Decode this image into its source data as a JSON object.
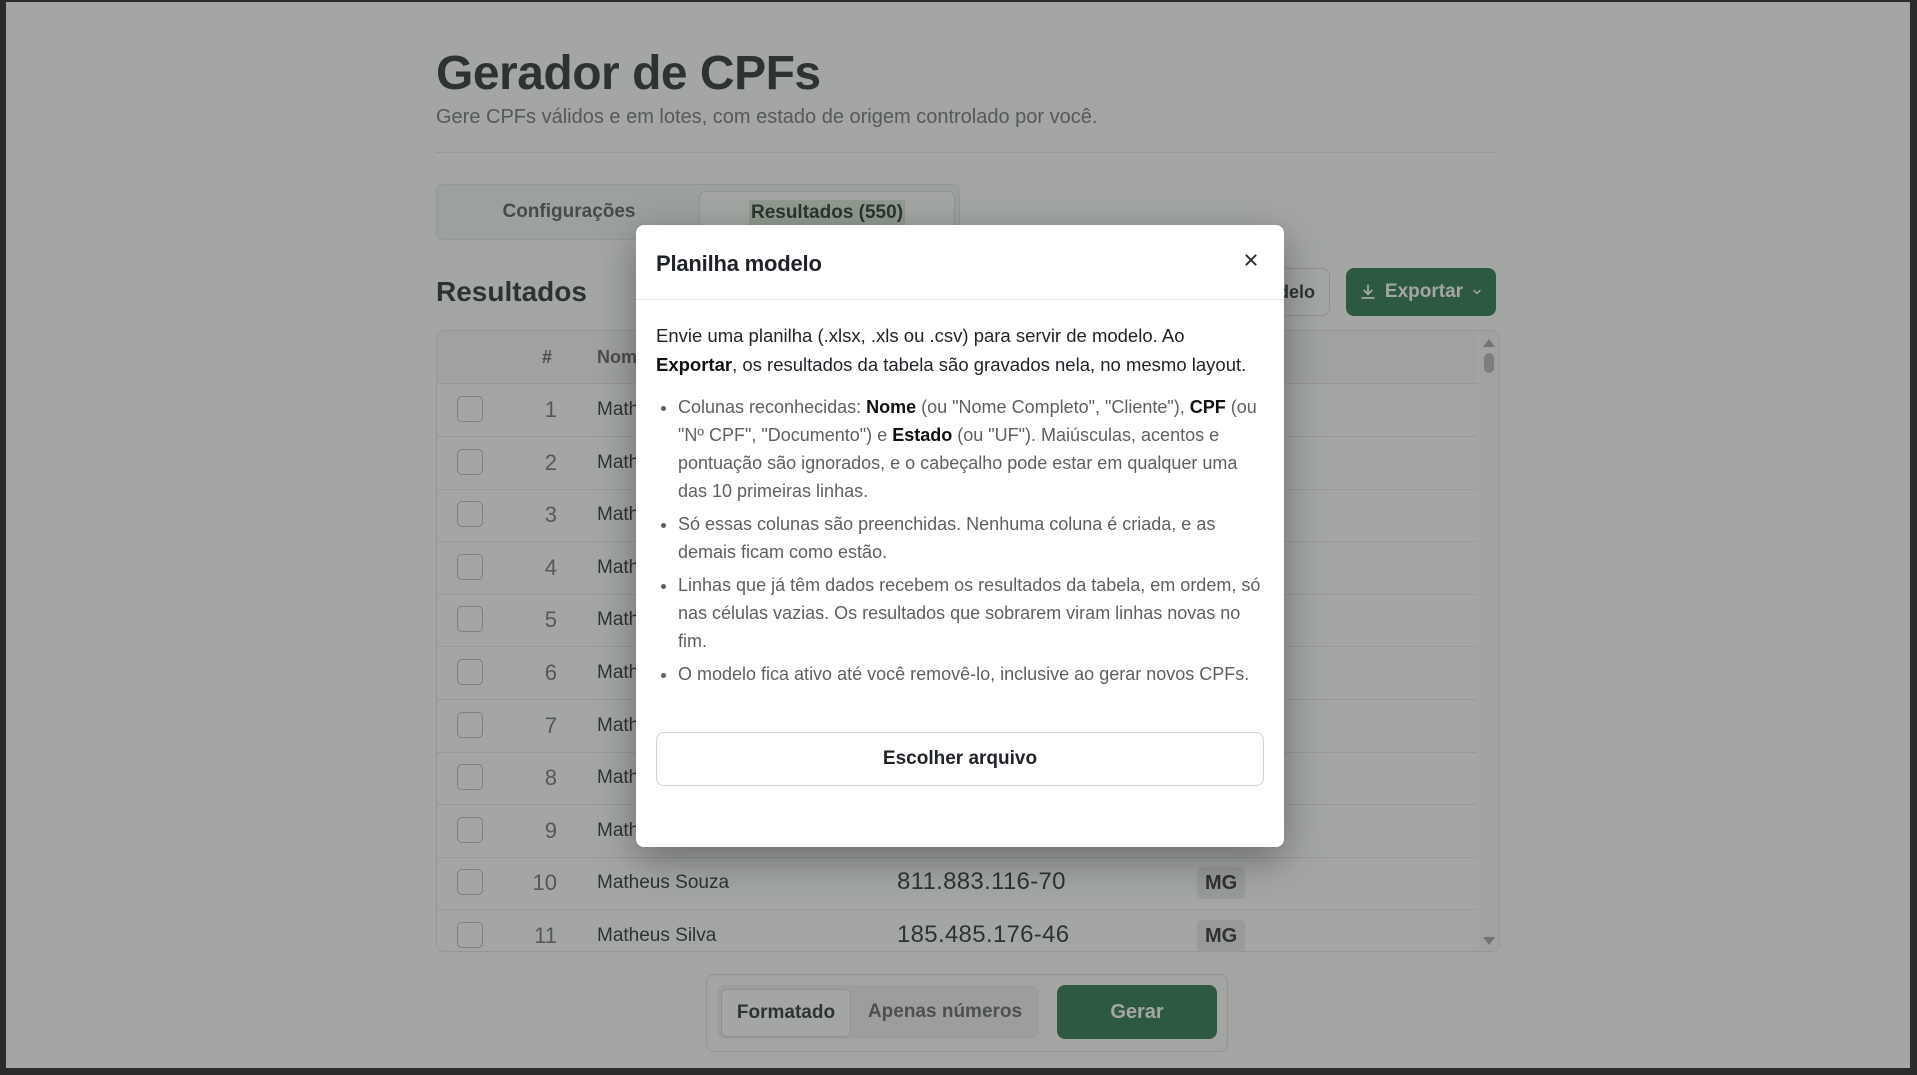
{
  "header": {
    "title": "Gerador de CPFs",
    "subtitle": "Gere CPFs válidos e em lotes, com estado de origem controlado por você."
  },
  "tabs": [
    {
      "label": "Configurações",
      "active": false
    },
    {
      "label": "Resultados (550)",
      "active": true
    }
  ],
  "results": {
    "title": "Resultados",
    "modelo_button_label": "delo",
    "export_button_label": "Exportar"
  },
  "table": {
    "headers": {
      "index": "#",
      "nome": "Nome"
    },
    "rows": [
      {
        "index": "1",
        "nome": "Math",
        "cpf": "",
        "uf": ""
      },
      {
        "index": "2",
        "nome": "Math",
        "cpf": "",
        "uf": ""
      },
      {
        "index": "3",
        "nome": "Math",
        "cpf": "",
        "uf": ""
      },
      {
        "index": "4",
        "nome": "Math",
        "cpf": "",
        "uf": ""
      },
      {
        "index": "5",
        "nome": "Math",
        "cpf": "",
        "uf": ""
      },
      {
        "index": "6",
        "nome": "Math",
        "cpf": "",
        "uf": ""
      },
      {
        "index": "7",
        "nome": "Math",
        "cpf": "",
        "uf": ""
      },
      {
        "index": "8",
        "nome": "Math",
        "cpf": "",
        "uf": ""
      },
      {
        "index": "9",
        "nome": "Math",
        "cpf": "",
        "uf": ""
      },
      {
        "index": "10",
        "nome": "Matheus Souza",
        "cpf": "811.883.116-70",
        "uf": "MG"
      },
      {
        "index": "11",
        "nome": "Matheus Silva",
        "cpf": "185.485.176-46",
        "uf": "MG"
      }
    ]
  },
  "format": {
    "options": [
      {
        "label": "Formatado",
        "active": true
      },
      {
        "label": "Apenas números",
        "active": false
      }
    ],
    "generate_label": "Gerar"
  },
  "modal": {
    "title": "Planilha modelo",
    "intro_1": "Envie uma planilha (.xlsx, .xls ou .csv) para servir de modelo. Ao ",
    "intro_bold": "Exportar",
    "intro_2": ", os resultados da tabela são gravados nela, no mesmo layout.",
    "bullet1": {
      "p1": "Colunas reconhecidas: ",
      "b1": "Nome",
      "p2": " (ou \"Nome Completo\", \"Cliente\"), ",
      "b2": "CPF",
      "p3": " (ou \"Nº CPF\", \"Documento\") e ",
      "b3": "Estado",
      "p4": " (ou \"UF\"). Maiúsculas, acentos e pontuação são ignorados, e o cabeçalho pode estar em qualquer uma das 10 primeiras linhas."
    },
    "bullet2": "Só essas colunas são preenchidas. Nenhuma coluna é criada, e as demais ficam como estão.",
    "bullet3": "Linhas que já têm dados recebem os resultados da tabela, em ordem, só nas células vazias. Os resultados que sobrarem viram linhas novas no fim.",
    "bullet4": "O modelo fica ativo até você removê-lo, inclusive ao gerar novos CPFs.",
    "file_button_label": "Escolher arquivo"
  },
  "colors": {
    "primary": "#1f6b43",
    "tab_highlight": "#d9ead8",
    "overlay": "rgba(62,68,62,0.48)"
  }
}
